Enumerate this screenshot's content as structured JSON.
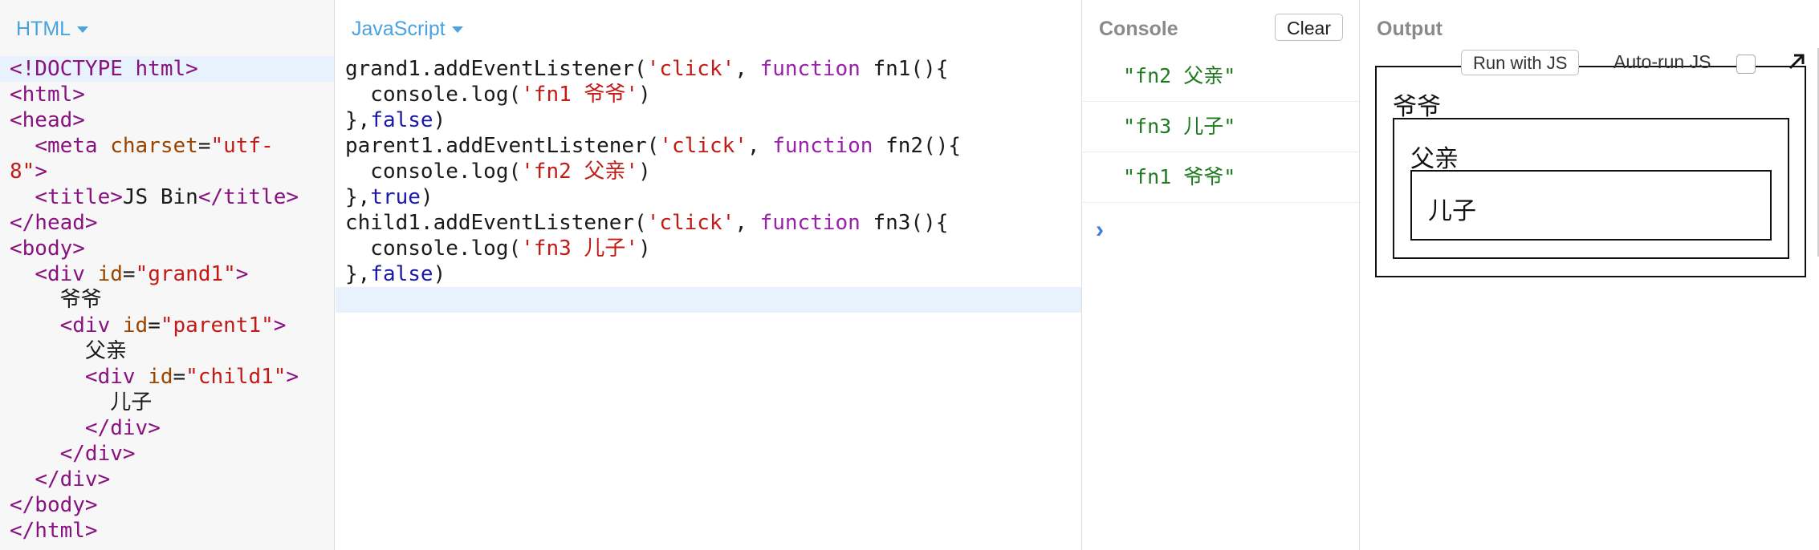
{
  "panels": {
    "html_label": "HTML",
    "js_label": "JavaScript",
    "console_label": "Console",
    "output_label": "Output"
  },
  "html_code": [
    [
      {
        "t": "t-tag",
        "v": "<!DOCTYPE html>"
      }
    ],
    [
      {
        "t": "t-tag",
        "v": "<html>"
      }
    ],
    [
      {
        "t": "t-tag",
        "v": "<head>"
      }
    ],
    [
      {
        "t": "t-plain",
        "v": "  "
      },
      {
        "t": "t-tag",
        "v": "<meta "
      },
      {
        "t": "t-attr",
        "v": "charset"
      },
      {
        "t": "t-plain",
        "v": "="
      },
      {
        "t": "t-str",
        "v": "\"utf-"
      }
    ],
    [
      {
        "t": "t-str",
        "v": "8\""
      },
      {
        "t": "t-tag",
        "v": ">"
      }
    ],
    [
      {
        "t": "t-plain",
        "v": "  "
      },
      {
        "t": "t-tag",
        "v": "<title>"
      },
      {
        "t": "t-plain",
        "v": "JS Bin"
      },
      {
        "t": "t-tag",
        "v": "</title>"
      }
    ],
    [
      {
        "t": "t-tag",
        "v": "</head>"
      }
    ],
    [
      {
        "t": "t-tag",
        "v": "<body>"
      }
    ],
    [
      {
        "t": "t-plain",
        "v": "  "
      },
      {
        "t": "t-tag",
        "v": "<div "
      },
      {
        "t": "t-attr",
        "v": "id"
      },
      {
        "t": "t-plain",
        "v": "="
      },
      {
        "t": "t-str",
        "v": "\"grand1\""
      },
      {
        "t": "t-tag",
        "v": ">"
      }
    ],
    [
      {
        "t": "t-plain",
        "v": "    爷爷"
      }
    ],
    [
      {
        "t": "t-plain",
        "v": "    "
      },
      {
        "t": "t-tag",
        "v": "<div "
      },
      {
        "t": "t-attr",
        "v": "id"
      },
      {
        "t": "t-plain",
        "v": "="
      },
      {
        "t": "t-str",
        "v": "\"parent1\""
      },
      {
        "t": "t-tag",
        "v": ">"
      }
    ],
    [
      {
        "t": "t-plain",
        "v": "      父亲"
      }
    ],
    [
      {
        "t": "t-plain",
        "v": "      "
      },
      {
        "t": "t-tag",
        "v": "<div "
      },
      {
        "t": "t-attr",
        "v": "id"
      },
      {
        "t": "t-plain",
        "v": "="
      },
      {
        "t": "t-str",
        "v": "\"child1\""
      },
      {
        "t": "t-tag",
        "v": ">"
      }
    ],
    [
      {
        "t": "t-plain",
        "v": "        儿子"
      }
    ],
    [
      {
        "t": "t-plain",
        "v": "      "
      },
      {
        "t": "t-tag",
        "v": "</div>"
      }
    ],
    [
      {
        "t": "t-plain",
        "v": "    "
      },
      {
        "t": "t-tag",
        "v": "</div>"
      }
    ],
    [
      {
        "t": "t-plain",
        "v": "  "
      },
      {
        "t": "t-tag",
        "v": "</div>"
      }
    ],
    [
      {
        "t": "t-tag",
        "v": "</body>"
      }
    ],
    [
      {
        "t": "t-tag",
        "v": "</html>"
      }
    ]
  ],
  "html_active_line": 0,
  "js_code": [
    [
      {
        "t": "t-plain",
        "v": "grand1.addEventListener("
      },
      {
        "t": "t-str",
        "v": "'click'"
      },
      {
        "t": "t-plain",
        "v": ", "
      },
      {
        "t": "t-kw",
        "v": "function"
      },
      {
        "t": "t-plain",
        "v": " fn1(){"
      }
    ],
    [
      {
        "t": "t-plain",
        "v": "  console.log("
      },
      {
        "t": "t-str",
        "v": "'fn1 爷爷'"
      },
      {
        "t": "t-plain",
        "v": ")"
      }
    ],
    [
      {
        "t": "t-plain",
        "v": "},"
      },
      {
        "t": "t-bool",
        "v": "false"
      },
      {
        "t": "t-plain",
        "v": ")"
      }
    ],
    [
      {
        "t": "t-plain",
        "v": "parent1.addEventListener("
      },
      {
        "t": "t-str",
        "v": "'click'"
      },
      {
        "t": "t-plain",
        "v": ", "
      },
      {
        "t": "t-kw",
        "v": "function"
      },
      {
        "t": "t-plain",
        "v": " fn2(){"
      }
    ],
    [
      {
        "t": "t-plain",
        "v": "  console.log("
      },
      {
        "t": "t-str",
        "v": "'fn2 父亲'"
      },
      {
        "t": "t-plain",
        "v": ")"
      }
    ],
    [
      {
        "t": "t-plain",
        "v": "},"
      },
      {
        "t": "t-bool",
        "v": "true"
      },
      {
        "t": "t-plain",
        "v": ")"
      }
    ],
    [
      {
        "t": "t-plain",
        "v": "child1.addEventListener("
      },
      {
        "t": "t-str",
        "v": "'click'"
      },
      {
        "t": "t-plain",
        "v": ", "
      },
      {
        "t": "t-kw",
        "v": "function"
      },
      {
        "t": "t-plain",
        "v": " fn3(){"
      }
    ],
    [
      {
        "t": "t-plain",
        "v": "  console.log("
      },
      {
        "t": "t-str",
        "v": "'fn3 儿子'"
      },
      {
        "t": "t-plain",
        "v": ")"
      }
    ],
    [
      {
        "t": "t-plain",
        "v": "},"
      },
      {
        "t": "t-bool",
        "v": "false"
      },
      {
        "t": "t-plain",
        "v": ")"
      }
    ],
    [
      {
        "t": "t-plain",
        "v": ""
      }
    ]
  ],
  "js_active_line": 9,
  "console": {
    "clear_label": "Clear",
    "entries": [
      "\"fn2 父亲\"",
      "\"fn3 儿子\"",
      "\"fn1 爷爷\""
    ],
    "prompt": "›"
  },
  "output": {
    "run_label": "Run with JS",
    "autorun_label": "Auto-run JS",
    "autorun_checked": false,
    "grand_text": "爷爷",
    "parent_text": "父亲",
    "child_text": "儿子"
  },
  "colors": {
    "label_blue": "#4aa3df",
    "console_green": "#1d7a1d",
    "tag": "#881280",
    "attr": "#994500",
    "string": "#c41a16",
    "keyword": "#9b1fad",
    "boolean": "#1a1aa6"
  }
}
